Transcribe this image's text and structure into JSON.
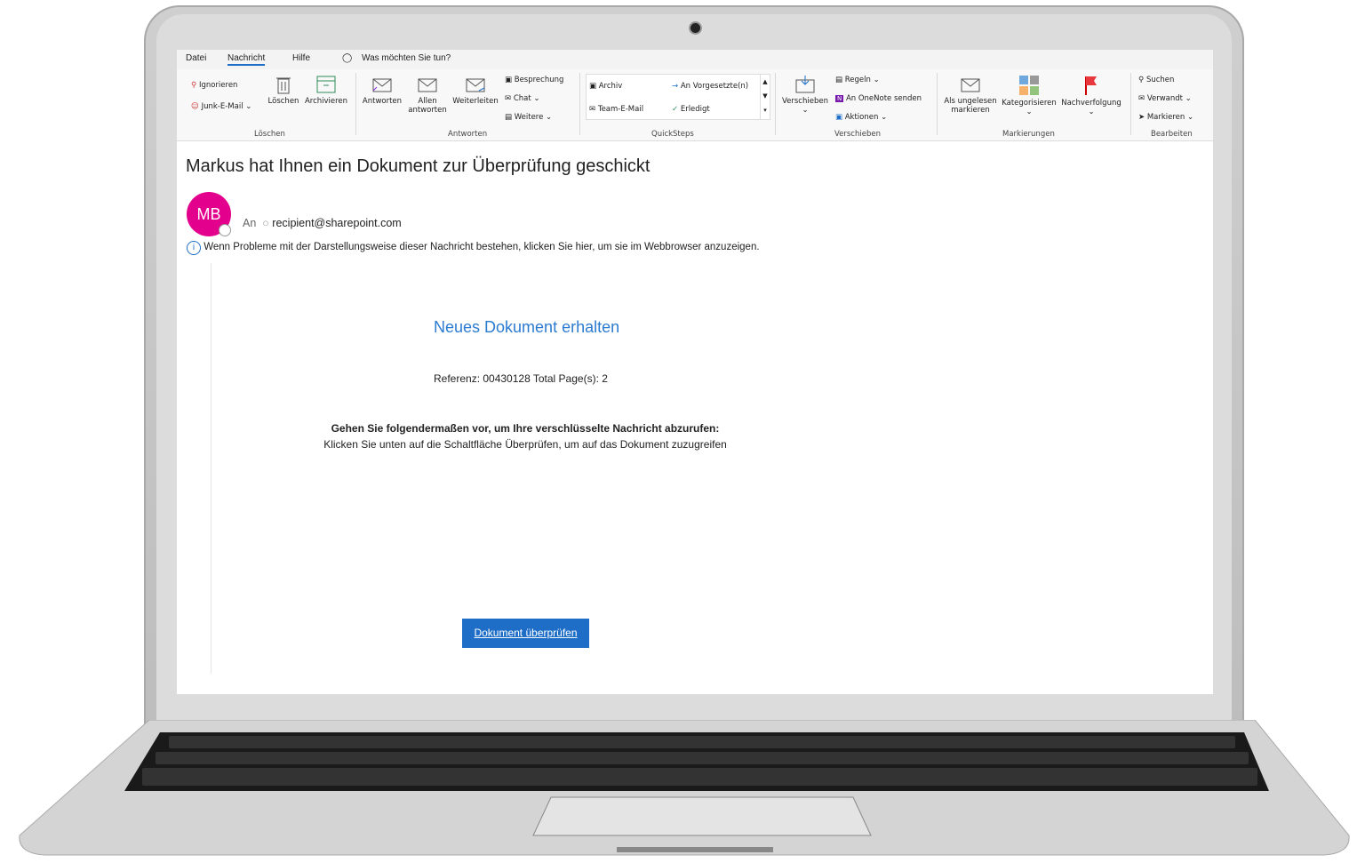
{
  "menu": {
    "file": "Datei",
    "message": "Nachricht",
    "help": "Hilfe",
    "tellme": "Was möchten Sie tun?"
  },
  "ribbon": {
    "ignore": "Ignorieren",
    "junk": "Junk-E-Mail",
    "delete": "Löschen",
    "archive": "Archivieren",
    "group_delete": "Löschen",
    "reply": "Antworten",
    "reply_all_1": "Allen",
    "reply_all_2": "antworten",
    "forward": "Weiterleiten",
    "meeting": "Besprechung",
    "chat": "Chat",
    "more": "Weitere",
    "group_respond": "Antworten",
    "qs_archive": "Archiv",
    "qs_manager": "An Vorgesetzte(n)",
    "qs_team": "Team-E-Mail",
    "qs_done": "Erledigt",
    "group_quicksteps": "QuickSteps",
    "move": "Verschieben",
    "rules": "Regeln",
    "onenote": "An OneNote senden",
    "actions": "Aktionen",
    "group_move": "Verschieben",
    "unread_1": "Als ungelesen",
    "unread_2": "markieren",
    "categorize": "Kategorisieren",
    "followup": "Nachverfolgung",
    "group_tags": "Markierungen",
    "search": "Suchen",
    "related": "Verwandt",
    "select": "Markieren",
    "group_edit": "Bearbeiten"
  },
  "email": {
    "subject": "Markus hat Ihnen ein Dokument zur Überprüfung geschickt",
    "avatar_initials": "MB",
    "to_label": "An",
    "recipient": "recipient@sharepoint.com",
    "info_bar": "Wenn Probleme mit der Darstellungsweise dieser Nachricht bestehen, klicken Sie hier, um sie im Webbrowser anzuzeigen.",
    "heading": "Neues Dokument erhalten",
    "reference": "Referenz: 00430128 Total Page(s):  2",
    "instruction_bold": "Gehen Sie folgendermaßen vor, um Ihre verschlüsselte Nachricht abzurufen:",
    "instruction_text": "Klicken Sie unten auf die Schaltfläche Überprüfen, um auf das Dokument zuzugreifen",
    "button": "Dokument überprüfen"
  },
  "colors": {
    "accent": "#2b7bd1",
    "button": "#1e6ec8",
    "avatar": "#e3008c",
    "flag": "#e8383d"
  }
}
